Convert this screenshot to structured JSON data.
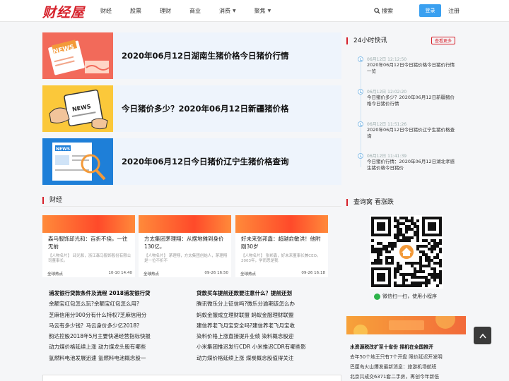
{
  "header": {
    "logo": "财经屋",
    "nav": [
      {
        "label": "财经",
        "caret": false
      },
      {
        "label": "股票",
        "caret": false
      },
      {
        "label": "理财",
        "caret": false
      },
      {
        "label": "商业",
        "caret": false
      },
      {
        "label": "消费",
        "caret": true
      },
      {
        "label": "聚焦",
        "caret": true
      }
    ],
    "search_label": "搜索",
    "login_label": "登录",
    "register_label": "注册"
  },
  "featured": [
    {
      "title": "2020年06月12日湖南生猪价格今日猪价行情",
      "thumb_label": "NEWS"
    },
    {
      "title": "今日猪价多少？2020年06月12日新疆猪价格",
      "thumb_label": "NEWS"
    },
    {
      "title": "2020年06月12日今日猪价辽宁生猪价格查询",
      "thumb_label": "NEWS"
    }
  ],
  "flash": {
    "title": "24小时快讯",
    "more_label": "查看更多",
    "items": [
      {
        "time": "06月12日 12:12:50",
        "text": "2020年06月12日今日猪价格今日猪价行情一览"
      },
      {
        "time": "06月12日 12:02:20",
        "text": "今日猪价多少？2020年06月12日新疆猪价格今日猪价行情"
      },
      {
        "time": "06月12日 11:51:26",
        "text": "2020年06月12日今日猪价辽宁生猪价格查询"
      },
      {
        "time": "06月12日 11:41:39",
        "text": "今日猪价行情：2020年06月12日湖北孝感生猪价格今日猪价"
      }
    ]
  },
  "finance": {
    "title": "财经",
    "cards": [
      {
        "title": "森马服饰邱光和：百折不挠，一往无前",
        "summary": "【人物名片】 邱光和，浙江森马服饰股份有限公司董事长。",
        "tag": "全球热点",
        "date": "10-10 14:40"
      },
      {
        "title": "方太集团茅理翔：从摆地摊到身价130亿，",
        "summary": "【人物名片】 茅理翔，方太集团创始人，茅理翔是一位不折不",
        "tag": "全球热点",
        "date": "09-26 16:50"
      },
      {
        "title": "好未来张邦鑫：超越俞敏洪！他附刚30岁",
        "summary": "【人物名片】 张邦鑫，好未来董事长兼CEO。 2003年，学而思是我",
        "tag": "全球热点",
        "date": "09-26 16:18"
      }
    ],
    "list_left": [
      "浦发银行贷款条件及流程 2018浦发银行贷",
      "余额宝红包怎么玩?余额宝红包怎么用?",
      "芝麻信用分900分有什么特权?芝麻信用分",
      "马云有多少钱？马云身价多少亿2018？",
      "韵达控股2018年5月主要快递经营指标快报",
      "动力煤价格延续上涨 动力煤龙头股有哪些",
      "氢燃料电池发展迅速 氢燃料电池概念股一"
    ],
    "list_right": [
      "贷款买车提前还款要注意什么？提前还划",
      "腾讯微乐分上征信吗?微乐分逾期该怎么办",
      "蚂蚁金服成立理财联盟 蚂蚁金服理财联盟",
      "建信养老飞月宝安全吗?建信养老飞月宝收",
      "染料价格上涨直接提升业绩 染料概念股迎",
      "小米集团推迟发行CDR 小米推迟CDR有哪些影",
      "动力煤价格延续上涨 煤炭概念股值得关注"
    ]
  },
  "qr": {
    "title": "查询窝 看涨跌",
    "caption": "微信扫一扫，使用小程序"
  },
  "side_list": [
    "水资源税改扩至十省份 择机在全国推开",
    "去年50个地王只有7个开盘 限价延迟开发明",
    "巴厘岛火山爆发最新消息：旅游机场航班",
    "北京共成交6371套二手房，再创今年新低"
  ]
}
